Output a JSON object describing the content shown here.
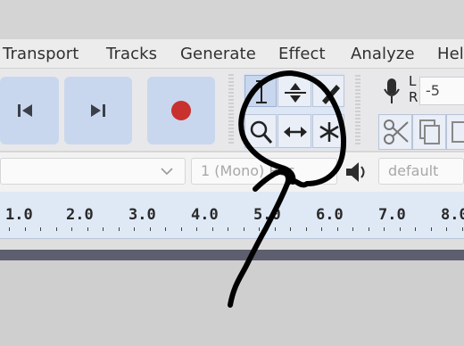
{
  "menu": {
    "items": [
      "Transport",
      "Tracks",
      "Generate",
      "Effect",
      "Analyze",
      "Hel"
    ]
  },
  "meter": {
    "l_label": "L",
    "r_label": "R",
    "value": "-5"
  },
  "device": {
    "channels": "1 (Mono) Rec",
    "output": "default"
  },
  "ruler": {
    "labels": [
      "1.0",
      "2.0",
      "3.0",
      "4.0",
      "5.0",
      "6.0",
      "7.0",
      "8.0"
    ]
  },
  "colors": {
    "record": "#c8312d",
    "button_face": "#c9d7ee",
    "ink": "#000000"
  }
}
